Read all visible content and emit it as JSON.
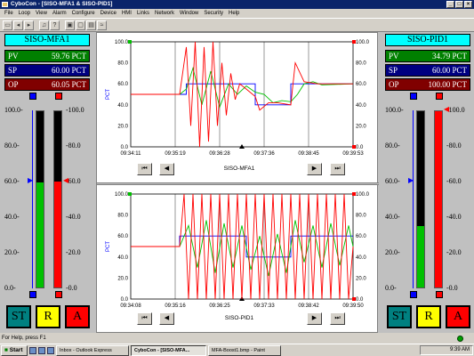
{
  "window": {
    "title": "CyboCon - [SISO-MFA1 & SISO-PID1]"
  },
  "menu": [
    "File",
    "Loop",
    "View",
    "Alarm",
    "Configure",
    "Device",
    "HMI",
    "Links",
    "Network",
    "Window",
    "Security",
    "Help"
  ],
  "left_panel": {
    "title": "SISO-MFA1",
    "pv": {
      "label": "PV",
      "value": "59.76 PCT",
      "level": 59.76
    },
    "sp": {
      "label": "SP",
      "value": "60.00 PCT",
      "level": 60.0
    },
    "op": {
      "label": "OP",
      "value": "60.05 PCT",
      "level": 60.05
    },
    "scale": [
      "100.0-",
      "80.0-",
      "60.0-",
      "40.0-",
      "20.0-",
      "0.0-"
    ],
    "scale_right": [
      "-100.0",
      "-80.0",
      "-60.0",
      "-40.0",
      "-20.0",
      "-0.0"
    ],
    "buttons": {
      "st": "ST",
      "r": "R",
      "a": "A"
    }
  },
  "right_panel": {
    "title": "SISO-PID1",
    "pv": {
      "label": "PV",
      "value": "34.79 PCT",
      "level": 34.79
    },
    "sp": {
      "label": "SP",
      "value": "60.00 PCT",
      "level": 60.0
    },
    "op": {
      "label": "OP",
      "value": "100.00 PCT",
      "level": 100.0
    },
    "scale": [
      "100.0-",
      "80.0-",
      "60.0-",
      "40.0-",
      "20.0-",
      "0.0-"
    ],
    "scale_right": [
      "-100.0",
      "-80.0",
      "-60.0",
      "-40.0",
      "-20.0",
      "-0.0"
    ],
    "buttons": {
      "st": "ST",
      "r": "R",
      "a": "A"
    }
  },
  "colors": {
    "pv": "#00c000",
    "sp": "#0000ff",
    "op": "#ff0000"
  },
  "chart_data": [
    {
      "type": "line",
      "name": "SISO-MFA1",
      "ylabel": "PCT",
      "ylim": [
        0,
        100
      ],
      "yticks": [
        "100.0",
        "80.0",
        "60.0",
        "40.0",
        "20.0",
        "0.0"
      ],
      "xticks": [
        "09:34:11",
        "09:35:19",
        "09:36:28",
        "09:37:36",
        "09:38:45",
        "09:39:53"
      ],
      "series": [
        {
          "color": "#0000ff",
          "x": [
            0,
            0.25,
            0.25,
            0.56,
            0.56,
            0.72,
            0.72,
            1
          ],
          "y": [
            50,
            50,
            60,
            60,
            40,
            40,
            60,
            60
          ]
        },
        {
          "color": "#00c000",
          "x": [
            0,
            0.22,
            0.25,
            0.28,
            0.32,
            0.36,
            0.4,
            0.44,
            0.48,
            0.52,
            0.56,
            0.6,
            0.64,
            0.68,
            0.72,
            0.75,
            0.78,
            0.82,
            0.86,
            1
          ],
          "y": [
            50,
            50,
            55,
            75,
            40,
            72,
            38,
            60,
            50,
            58,
            52,
            50,
            42,
            44,
            43,
            50,
            60,
            62,
            59,
            60
          ]
        },
        {
          "color": "#ff0000",
          "x": [
            0,
            0.22,
            0.25,
            0.27,
            0.29,
            0.31,
            0.33,
            0.35,
            0.37,
            0.39,
            0.41,
            0.43,
            0.45,
            0.47,
            0.49,
            0.52,
            0.56,
            0.58,
            0.62,
            0.66,
            0.72,
            0.74,
            0.78,
            0.84,
            1
          ],
          "y": [
            50,
            50,
            95,
            20,
            100,
            0,
            95,
            5,
            100,
            20,
            80,
            30,
            70,
            45,
            60,
            55,
            48,
            35,
            42,
            42,
            40,
            80,
            62,
            60,
            60
          ]
        }
      ]
    },
    {
      "type": "line",
      "name": "SISO-PID1",
      "ylabel": "PCT",
      "ylim": [
        0,
        100
      ],
      "yticks": [
        "100.0",
        "80.0",
        "60.0",
        "40.0",
        "20.0",
        "0.0"
      ],
      "xticks": [
        "09:34:08",
        "09:35:16",
        "09:36:25",
        "09:37:33",
        "09:38:42",
        "09:39:50"
      ],
      "series": [
        {
          "color": "#0000ff",
          "x": [
            0,
            0.22,
            0.22,
            0.52,
            0.52,
            0.72,
            0.72,
            1
          ],
          "y": [
            50,
            50,
            60,
            60,
            40,
            40,
            60,
            60
          ]
        },
        {
          "color": "#00c000",
          "x": [
            0,
            0.22,
            0.26,
            0.3,
            0.34,
            0.38,
            0.42,
            0.46,
            0.5,
            0.54,
            0.58,
            0.62,
            0.66,
            0.7,
            0.74,
            0.78,
            0.82,
            0.86,
            0.9,
            0.94,
            0.98,
            1
          ],
          "y": [
            50,
            50,
            70,
            30,
            75,
            25,
            72,
            30,
            70,
            28,
            60,
            22,
            62,
            25,
            75,
            35,
            70,
            30,
            72,
            32,
            70,
            50
          ]
        },
        {
          "color": "#ff0000",
          "x": [
            0,
            0.22,
            0.24,
            0.26,
            0.28,
            0.3,
            0.32,
            0.34,
            0.36,
            0.38,
            0.4,
            0.42,
            0.44,
            0.46,
            0.48,
            0.5,
            0.52,
            0.54,
            0.56,
            0.58,
            0.6,
            0.62,
            0.64,
            0.66,
            0.68,
            0.7,
            0.72,
            0.74,
            0.76,
            0.78,
            0.8,
            0.82,
            0.84,
            0.86,
            0.88,
            0.9,
            0.92,
            0.94,
            0.96,
            0.98,
            1
          ],
          "y": [
            50,
            50,
            100,
            0,
            100,
            0,
            100,
            0,
            100,
            0,
            100,
            0,
            100,
            0,
            100,
            0,
            100,
            0,
            100,
            0,
            100,
            0,
            100,
            0,
            100,
            0,
            100,
            0,
            100,
            0,
            100,
            0,
            100,
            0,
            100,
            0,
            100,
            0,
            100,
            0,
            50
          ]
        }
      ]
    }
  ],
  "status": {
    "text": "For Help, press F1"
  },
  "taskbar": {
    "start": "Start",
    "tasks": [
      "Inbox - Outlook Express",
      "CyboCon - [SISO-MFA...",
      "MFA-Boost1.bmp - Paint"
    ],
    "clock": "9:39 AM"
  }
}
